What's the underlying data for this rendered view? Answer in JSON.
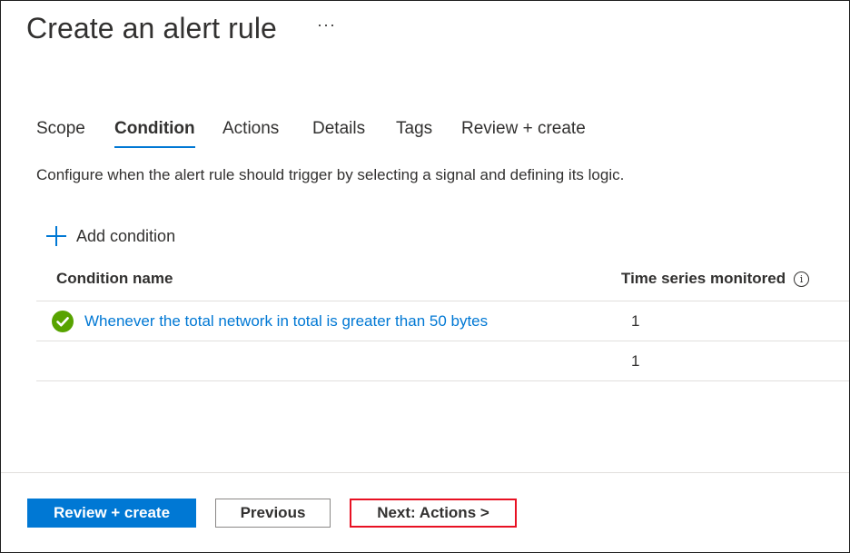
{
  "page": {
    "title": "Create an alert rule",
    "more_label": "···"
  },
  "tabs": [
    {
      "label": "Scope",
      "active": false
    },
    {
      "label": "Condition",
      "active": true
    },
    {
      "label": "Actions",
      "active": false
    },
    {
      "label": "Details",
      "active": false
    },
    {
      "label": "Tags",
      "active": false
    },
    {
      "label": "Review + create",
      "active": false
    }
  ],
  "description": "Configure when the alert rule should trigger by selecting a signal and defining its logic.",
  "add_condition": {
    "icon": "plus-icon",
    "label": "Add condition"
  },
  "table": {
    "headers": {
      "condition_name": "Condition name",
      "time_series": "Time series monitored",
      "info_icon": "info-icon"
    },
    "rows": [
      {
        "status_icon": "check-circle-icon",
        "status_color": "#57a300",
        "name": "Whenever the total network in total is greater than 50 bytes",
        "time_series": "1"
      },
      {
        "status_icon": "",
        "name": "",
        "time_series": "1"
      }
    ]
  },
  "footer": {
    "review_create_label": "Review + create",
    "previous_label": "Previous",
    "next_label": "Next: Actions >"
  },
  "colors": {
    "accent": "#0078d4",
    "success": "#57a300",
    "highlight_border": "#e81123"
  }
}
